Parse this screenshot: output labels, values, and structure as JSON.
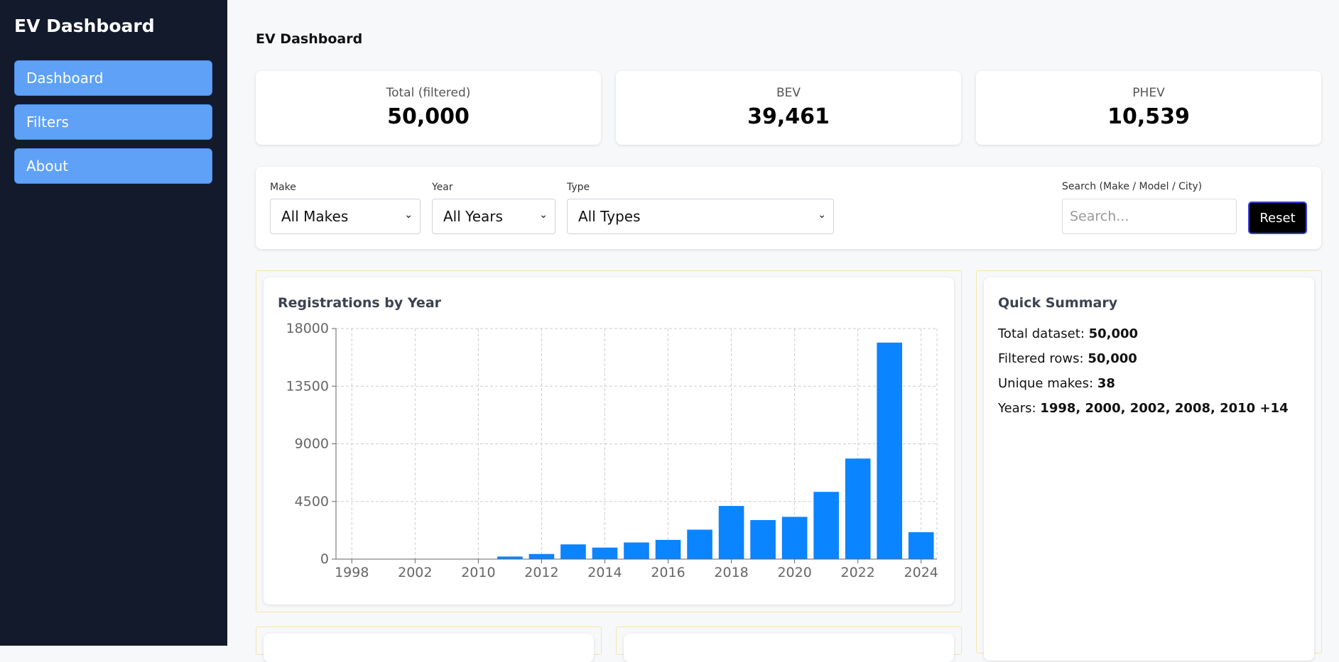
{
  "sidebar": {
    "brand": "EV Dashboard",
    "items": [
      {
        "label": "Dashboard"
      },
      {
        "label": "Filters"
      },
      {
        "label": "About"
      }
    ]
  },
  "main": {
    "title": "EV Dashboard"
  },
  "stats": [
    {
      "label": "Total (filtered)",
      "value": "50,000"
    },
    {
      "label": "BEV",
      "value": "39,461"
    },
    {
      "label": "PHEV",
      "value": "10,539"
    }
  ],
  "filters": {
    "make": {
      "label": "Make",
      "selected": "All Makes"
    },
    "year": {
      "label": "Year",
      "selected": "All Years"
    },
    "type": {
      "label": "Type",
      "selected": "All Types"
    },
    "search": {
      "label": "Search (Make / Model / City)",
      "placeholder": "Search..."
    },
    "reset_label": "Reset"
  },
  "chart_panel": {
    "title": "Registrations by Year"
  },
  "summary": {
    "title": "Quick Summary",
    "lines": [
      {
        "label": "Total dataset:",
        "value": "50,000"
      },
      {
        "label": "Filtered rows:",
        "value": "50,000"
      },
      {
        "label": "Unique makes:",
        "value": "38"
      },
      {
        "label": "Years:",
        "value": "1998, 2000, 2002, 2008, 2010 +14"
      }
    ]
  },
  "colors": {
    "sidebar_bg": "#121a2b",
    "nav_item_bg": "#5ea1f7",
    "bar": "#0a84ff",
    "reset_bg": "#000000",
    "panel_outline": "#f3e6a8"
  },
  "chart_data": {
    "type": "bar",
    "title": "Registrations by Year",
    "xlabel": "",
    "ylabel": "",
    "categories": [
      "1998",
      "2000",
      "2002",
      "2008",
      "2010",
      "2011",
      "2012",
      "2013",
      "2014",
      "2015",
      "2016",
      "2017",
      "2018",
      "2019",
      "2020",
      "2021",
      "2022",
      "2023",
      "2024"
    ],
    "x_tick_labels": [
      "1998",
      "2002",
      "2010",
      "2012",
      "2014",
      "2016",
      "2018",
      "2020",
      "2022",
      "2024"
    ],
    "values": [
      2,
      2,
      2,
      2,
      10,
      200,
      400,
      1150,
      900,
      1300,
      1500,
      2300,
      4150,
      3050,
      3300,
      5250,
      7850,
      16900,
      2100
    ],
    "ylim": [
      0,
      18000
    ],
    "y_ticks": [
      0,
      4500,
      9000,
      13500,
      18000
    ],
    "grid": true,
    "legend": "none"
  }
}
